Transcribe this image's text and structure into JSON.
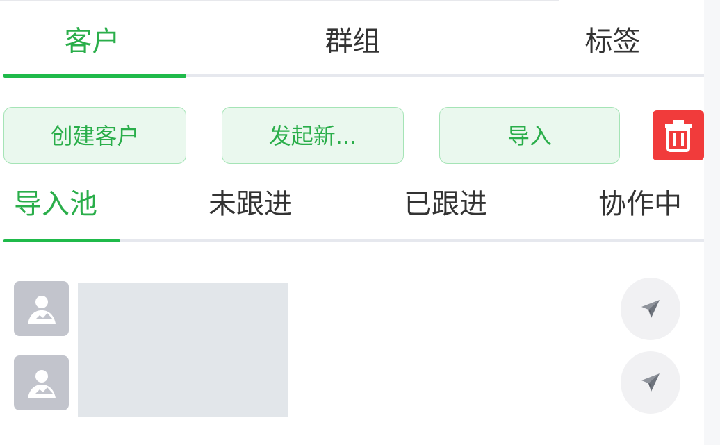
{
  "main_tabs": [
    {
      "label": "客户",
      "active": true
    },
    {
      "label": "群组",
      "active": false
    },
    {
      "label": "标签",
      "active": false
    }
  ],
  "actions": {
    "create_customer": "创建客户",
    "start_new": "发起新...",
    "import": "导入",
    "delete_icon": "trash-icon"
  },
  "sub_tabs": [
    {
      "label": "导入池",
      "active": true
    },
    {
      "label": "未跟进",
      "active": false
    },
    {
      "label": "已跟进",
      "active": false
    },
    {
      "label": "协作中",
      "active": false
    }
  ],
  "list": {
    "items": [
      {
        "avatar_icon": "person-icon",
        "action_icon": "send-icon"
      },
      {
        "avatar_icon": "person-icon",
        "action_icon": "send-icon"
      }
    ]
  },
  "colors": {
    "accent": "#2aae4a",
    "button_bg": "#eaf8ee",
    "button_border": "#a5e4b6",
    "danger": "#f13b3b",
    "avatar_bg": "#c2c4cc",
    "placeholder_bg": "#e2e6ea"
  }
}
